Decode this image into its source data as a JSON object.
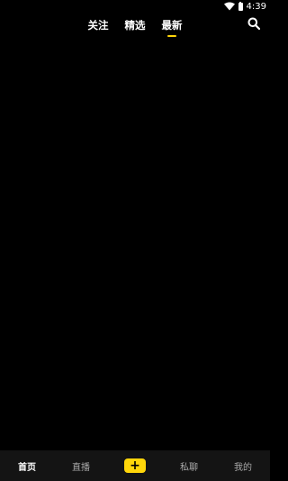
{
  "status_bar": {
    "time": "4:39"
  },
  "top_tabs": [
    {
      "label": "关注",
      "active": false
    },
    {
      "label": "精选",
      "active": false
    },
    {
      "label": "最新",
      "active": true
    }
  ],
  "bottom_nav": {
    "items": [
      {
        "label": "首页",
        "active": true
      },
      {
        "label": "直播",
        "active": false
      },
      {
        "label": "+",
        "is_plus": true
      },
      {
        "label": "私聊",
        "active": false
      },
      {
        "label": "我的",
        "active": false
      }
    ]
  },
  "colors": {
    "background": "#000000",
    "accent": "#ffd60a",
    "nav_background": "#141414",
    "inactive_text": "#a9a9a9"
  },
  "icons": {
    "search": "search-icon",
    "wifi": "wifi-icon",
    "battery": "battery-icon"
  }
}
